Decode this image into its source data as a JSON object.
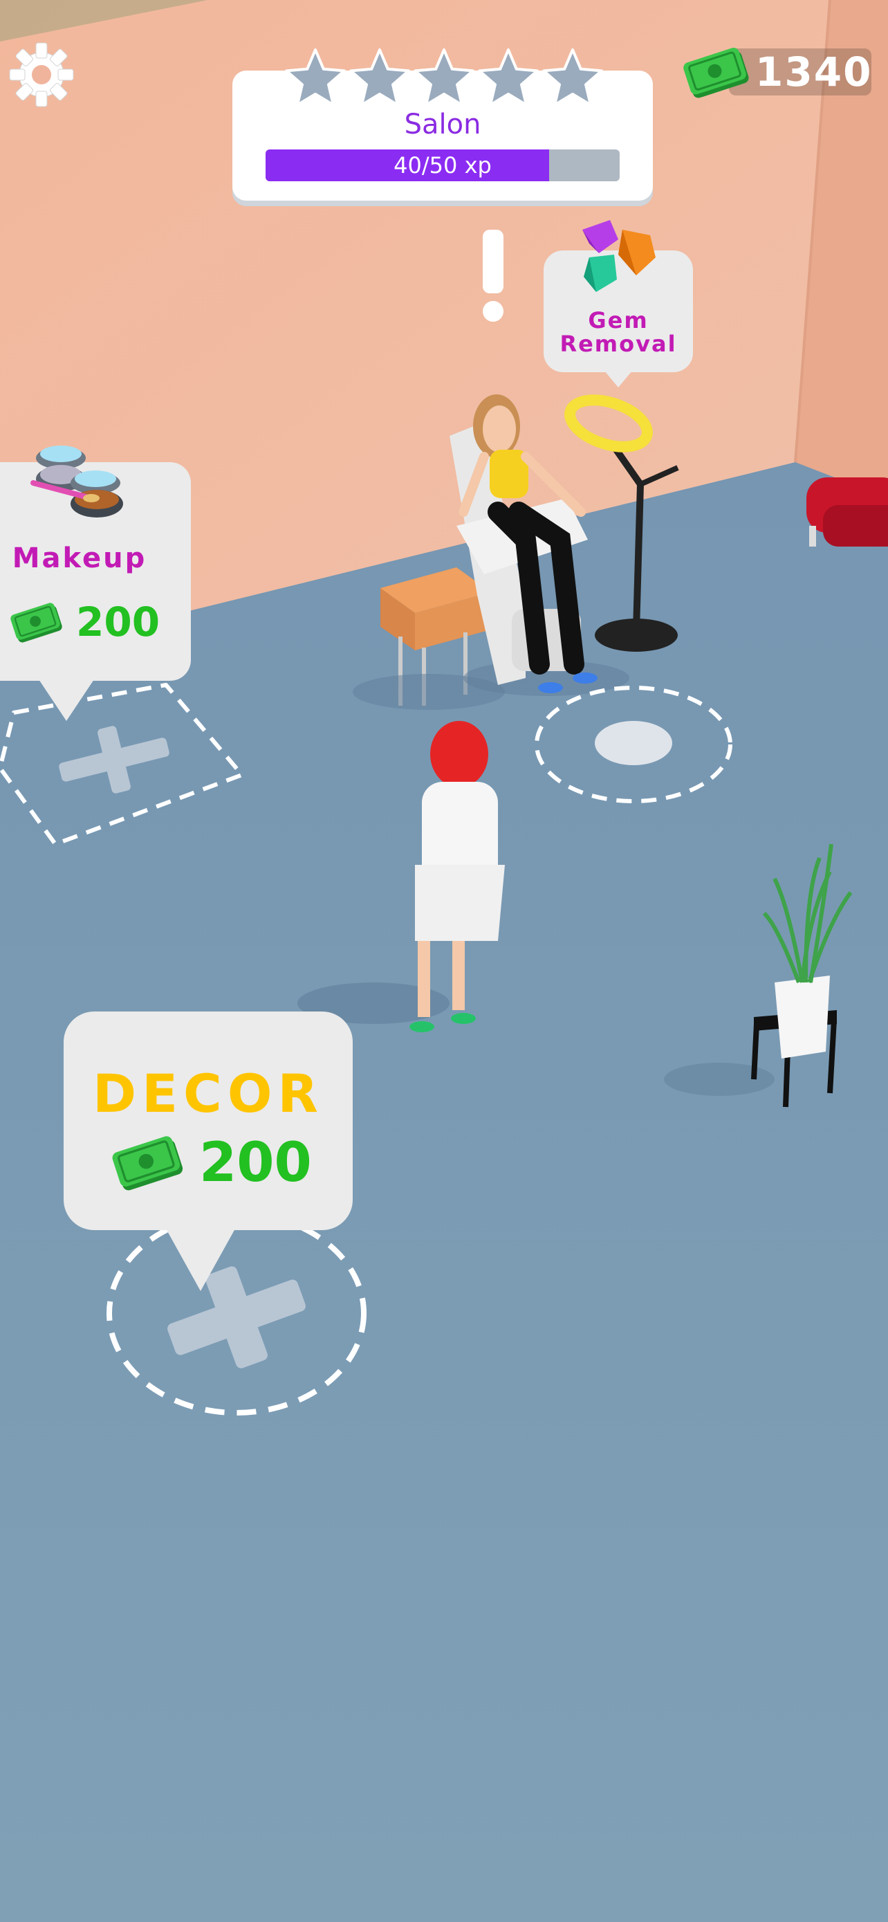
{
  "hud": {
    "settings_icon": "gear-icon",
    "money": "1340",
    "money_icon": "cash-icon"
  },
  "level": {
    "name": "Salon",
    "xp_text": "40/50 xp",
    "xp_progress": 0.8,
    "stars_total": 5,
    "stars_earned": 0
  },
  "stations": {
    "gem_removal": {
      "label": "Gem Removal",
      "icon": "gems-icon"
    },
    "makeup": {
      "label": "Makeup",
      "price": "200",
      "icon": "makeup-palette-icon",
      "price_icon": "cash-icon"
    },
    "decor": {
      "label": "DECOR",
      "price": "200",
      "price_icon": "cash-icon"
    }
  },
  "colors": {
    "floor": "#7b9ab4",
    "wall": "#efb49a",
    "xp_fill": "#8b2cf2",
    "xp_track": "#aeb8c2",
    "level_name": "#8a2be2",
    "station_label": "#c21bb5",
    "decor_label": "#ffc400",
    "price_green": "#22c021",
    "star_empty": "#9aabbe"
  }
}
